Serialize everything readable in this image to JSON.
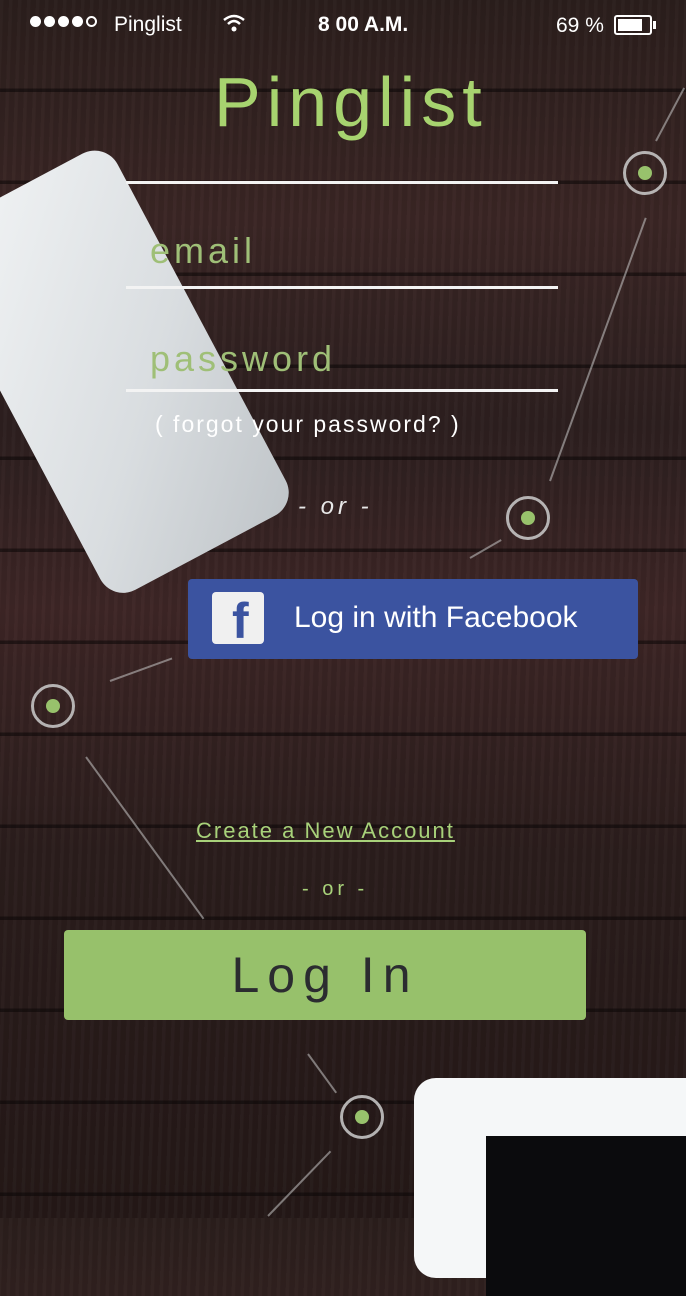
{
  "status_bar": {
    "carrier": "Pinglist",
    "time": "8 00 A.M.",
    "battery": "69 %"
  },
  "app": {
    "logo": "Pinglist"
  },
  "login_form": {
    "email_placeholder": "email",
    "password_placeholder": "password",
    "forgot_password": "( forgot your password? )",
    "or_separator_1": "- or -",
    "facebook_button": "Log in with Facebook",
    "create_account": "Create a New Account",
    "or_separator_2": "- or -",
    "login_button": "Log In"
  },
  "colors": {
    "accent_green": "#97c16b",
    "facebook_blue": "#3b53a0"
  }
}
